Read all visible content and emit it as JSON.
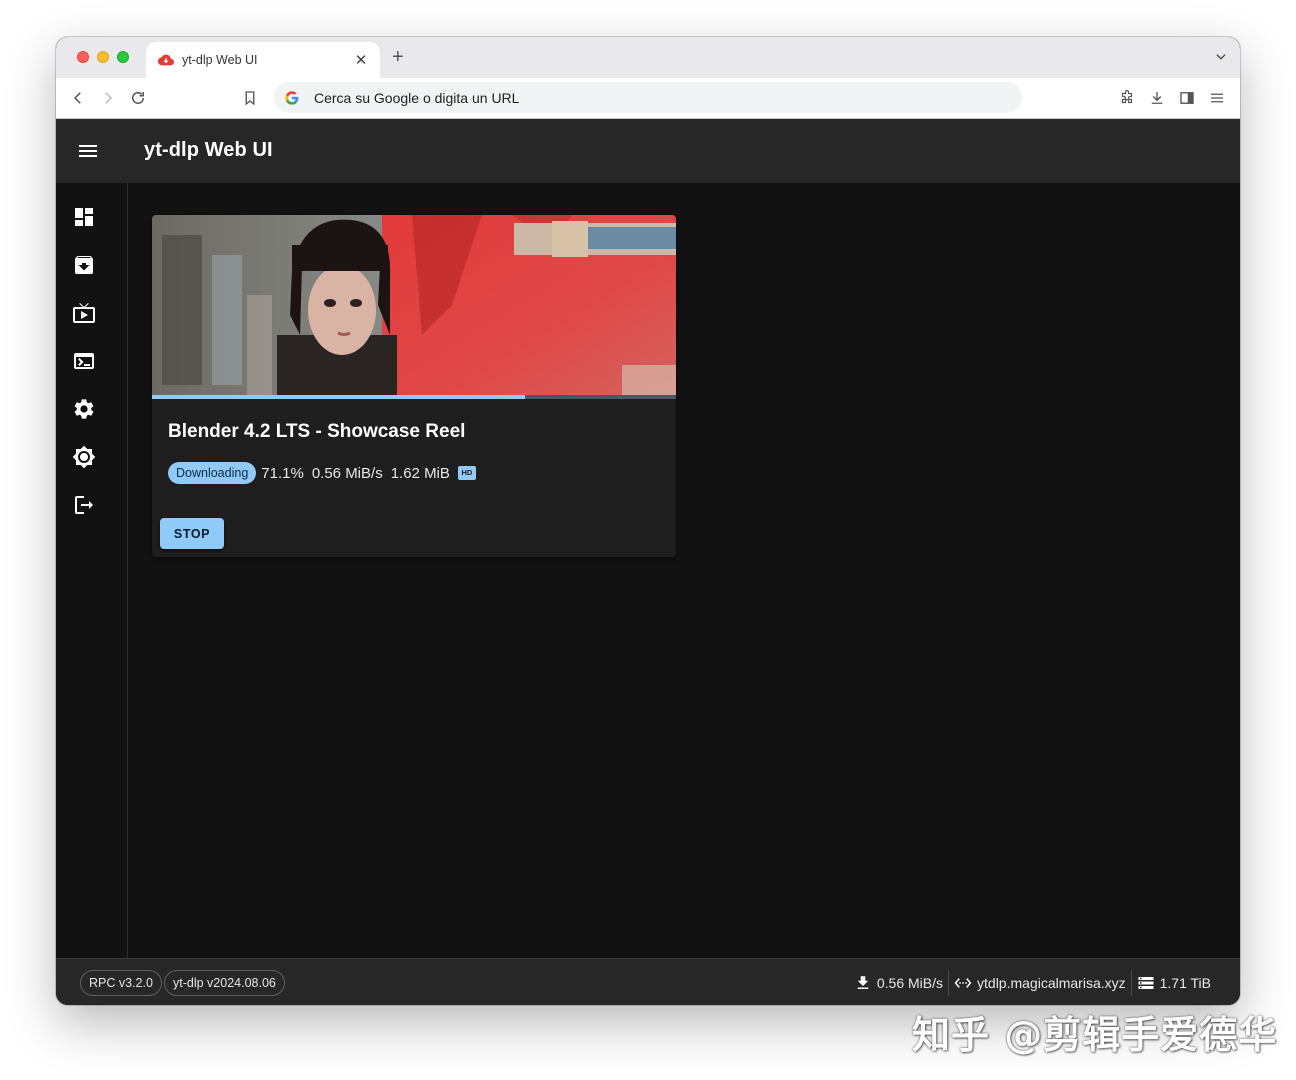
{
  "browser": {
    "tab_title": "yt-dlp Web UI",
    "omnibox_placeholder": "Cerca su Google o digita un URL"
  },
  "app": {
    "title": "yt-dlp Web UI",
    "accent_color": "#90caf9",
    "nav_items": [
      "dashboard-icon",
      "archive-icon",
      "livestream-icon",
      "terminal-icon",
      "settings-icon",
      "theme-icon",
      "logout-icon"
    ]
  },
  "download": {
    "title": "Blender 4.2 LTS - Showcase Reel",
    "status": "Downloading",
    "progress_text": "71.1%",
    "progress_fraction": 0.711,
    "speed": "0.56 MiB/s",
    "size": "1.62 MiB",
    "quality_badge": "HD",
    "stop_label": "STOP"
  },
  "footer": {
    "rpc_version": "RPC v3.2.0",
    "ytdlp_version": "yt-dlp v2024.08.06",
    "download_speed": "0.56 MiB/s",
    "server": "ytdlp.magicalmarisa.xyz",
    "free_space": "1.71 TiB"
  },
  "watermark": "知乎 @剪辑手爱德华"
}
